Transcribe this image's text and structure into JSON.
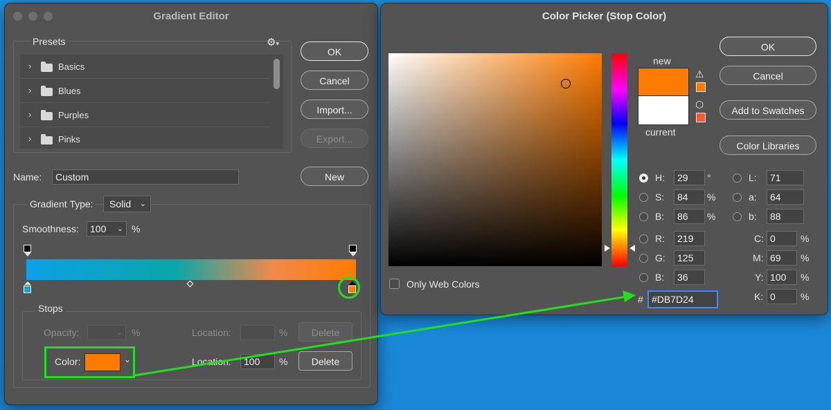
{
  "gradient_editor": {
    "title": "Gradient Editor",
    "presets_label": "Presets",
    "presets": [
      {
        "label": "Basics"
      },
      {
        "label": "Blues"
      },
      {
        "label": "Purples"
      },
      {
        "label": "Pinks"
      }
    ],
    "buttons": {
      "ok": "OK",
      "cancel": "Cancel",
      "import": "Import...",
      "export": "Export...",
      "new": "New"
    },
    "name_label": "Name:",
    "name_value": "Custom",
    "gradient_type_label": "Gradient Type:",
    "gradient_type_value": "Solid",
    "smoothness_label": "Smoothness:",
    "smoothness_value": "100",
    "smoothness_unit": "%",
    "gradient_colors": [
      "#0ea0e8",
      "#0aa6a8",
      "#f0894a",
      "#ff7a00"
    ],
    "stops": {
      "label": "Stops",
      "opacity_label": "Opacity:",
      "opacity_unit": "%",
      "location_label": "Location:",
      "location_unit": "%",
      "delete_label": "Delete",
      "color_label": "Color:",
      "color_location_value": "100",
      "color_swatch": "#ff7a00"
    }
  },
  "color_picker": {
    "title": "Color Picker (Stop Color)",
    "buttons": {
      "ok": "OK",
      "cancel": "Cancel",
      "add_to_swatches": "Add to Swatches",
      "color_libraries": "Color Libraries"
    },
    "new_label": "new",
    "current_label": "current",
    "new_color": "#ff7a00",
    "current_color": "#ffffff",
    "only_web_colors_label": "Only Web Colors",
    "hsb": [
      {
        "label": "H:",
        "value": "29",
        "unit": "°"
      },
      {
        "label": "S:",
        "value": "84",
        "unit": "%"
      },
      {
        "label": "B:",
        "value": "86",
        "unit": "%"
      }
    ],
    "rgb": [
      {
        "label": "R:",
        "value": "219"
      },
      {
        "label": "G:",
        "value": "125"
      },
      {
        "label": "B:",
        "value": "36"
      }
    ],
    "lab": [
      {
        "label": "L:",
        "value": "71"
      },
      {
        "label": "a:",
        "value": "64"
      },
      {
        "label": "b:",
        "value": "88"
      }
    ],
    "cmyk": [
      {
        "label": "C:",
        "value": "0",
        "unit": "%"
      },
      {
        "label": "M:",
        "value": "69",
        "unit": "%"
      },
      {
        "label": "Y:",
        "value": "100",
        "unit": "%"
      },
      {
        "label": "K:",
        "value": "0",
        "unit": "%"
      }
    ],
    "hex_label": "#",
    "hex_value": "#DB7D24"
  },
  "colors": {
    "highlight": "#22e020",
    "accent_orange": "#ff7a00",
    "stop_blue": "#1aa0e6"
  }
}
